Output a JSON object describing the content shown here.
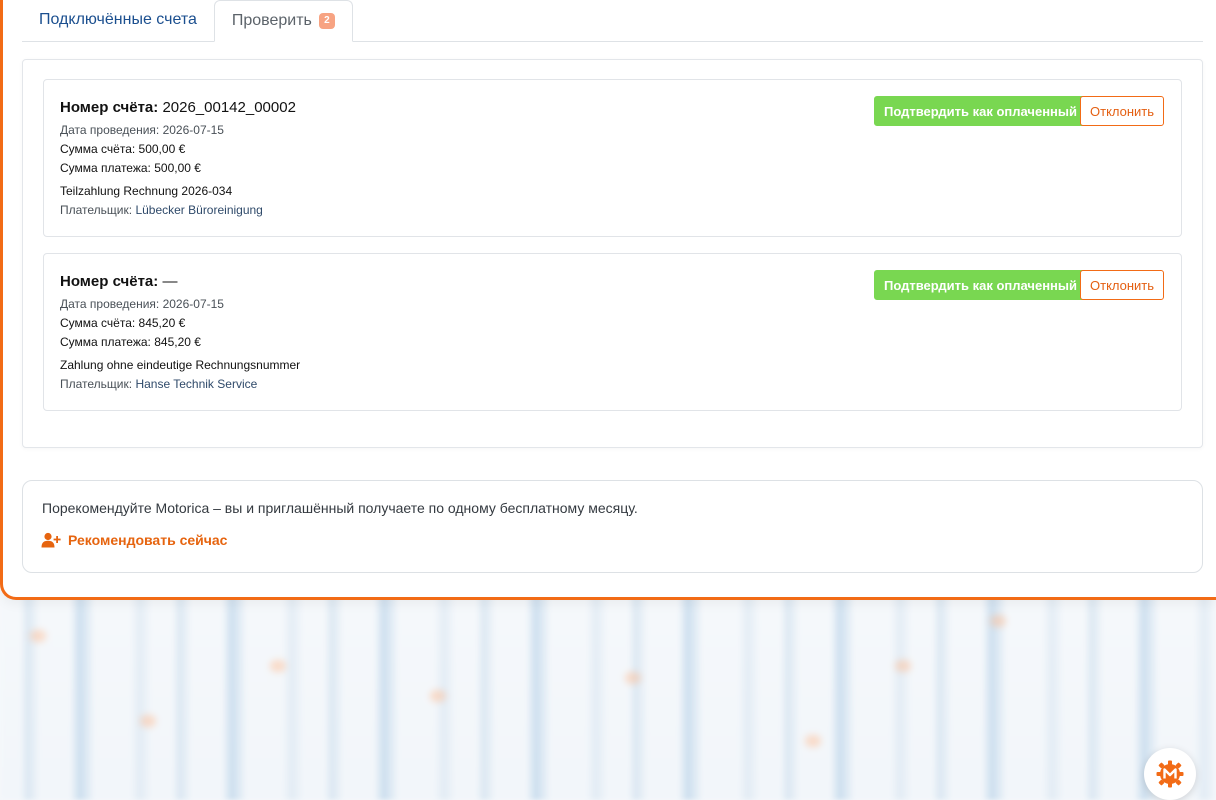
{
  "tabs": [
    {
      "label": "Подключённые счета"
    },
    {
      "label": "Проверить",
      "badge": "2"
    }
  ],
  "payments": [
    {
      "invoice_label": "Номер счёта:",
      "invoice_number": "2026_00142_00002",
      "date_text": "Дата проведения: 2026-07-15",
      "invoice_amount_text": "Сумма счёта: 500,00 €",
      "payment_amount_text": "Сумма платежа: 500,00 €",
      "reference": "Teilzahlung Rechnung 2026-034",
      "payer_label": "Плательщик:",
      "payer_name": "Lübecker Büroreinigung",
      "confirm_label": "Подтвердить как оплаченный",
      "reject_label": "Отклонить"
    },
    {
      "invoice_label": "Номер счёта:",
      "invoice_number": "—",
      "date_text": "Дата проведения: 2026-07-15",
      "invoice_amount_text": "Сумма счёта: 845,20 €",
      "payment_amount_text": "Сумма платежа: 845,20 €",
      "reference": "Zahlung ohne eindeutige Rechnungsnummer",
      "payer_label": "Плательщик:",
      "payer_name": "Hanse Technik Service",
      "confirm_label": "Подтвердить как оплаченный",
      "reject_label": "Отклонить"
    }
  ],
  "referral": {
    "text": "Порекомендуйте Motorica – вы и приглашённый получаете по одному бесплатному месяцу.",
    "link_label": "Рекомендовать сейчас",
    "link_icon": "user-plus-icon"
  },
  "fab": {
    "icon": "motorica-logo-icon"
  },
  "colors": {
    "accent": "#f26b16",
    "confirm": "#79d751",
    "badge": "#f7a382",
    "tab_active_text": "#1b4f8f"
  }
}
